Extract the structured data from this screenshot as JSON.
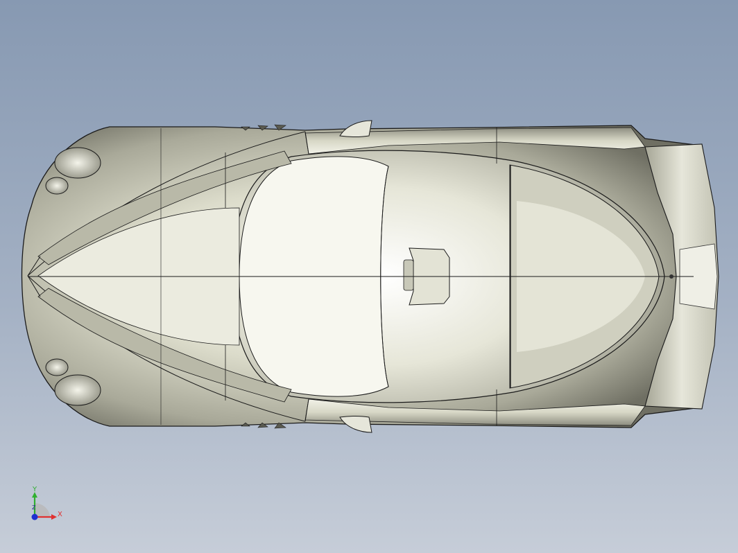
{
  "viewport": {
    "background_top": "#8799b2",
    "background_bottom": "#c6cdd8",
    "model": {
      "description_icon": "car-body-top-view",
      "surface_color": "#d8d8c8",
      "edge_color": "#1a1a1a"
    }
  },
  "triad": {
    "x_label": "X",
    "y_label": "Y",
    "z_label": "Z",
    "x_color": "#e03030",
    "y_color": "#30b030",
    "z_color": "#2030d0"
  }
}
